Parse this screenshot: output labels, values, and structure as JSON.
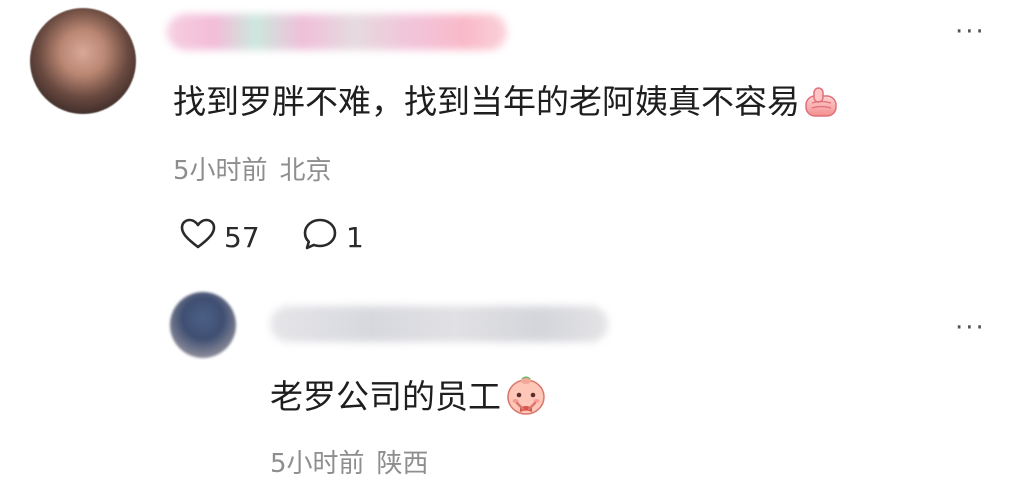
{
  "comment": {
    "more_label": "···",
    "text": "找到罗胖不难，找到当年的老阿姨真不容易",
    "emoji": "thumbs-up-emoji",
    "time": "5小时前",
    "location": "北京",
    "likes": "57",
    "replies": "1"
  },
  "reply": {
    "more_label": "···",
    "text": "老罗公司的员工",
    "emoji": "pleading-face-emoji",
    "time": "5小时前",
    "location": "陕西"
  },
  "icons": {
    "like": "heart-outline-icon",
    "reply": "speech-bubble-icon"
  },
  "colors": {
    "text": "#1e1e1e",
    "meta": "#8e8e8e",
    "background": "#ffffff"
  }
}
